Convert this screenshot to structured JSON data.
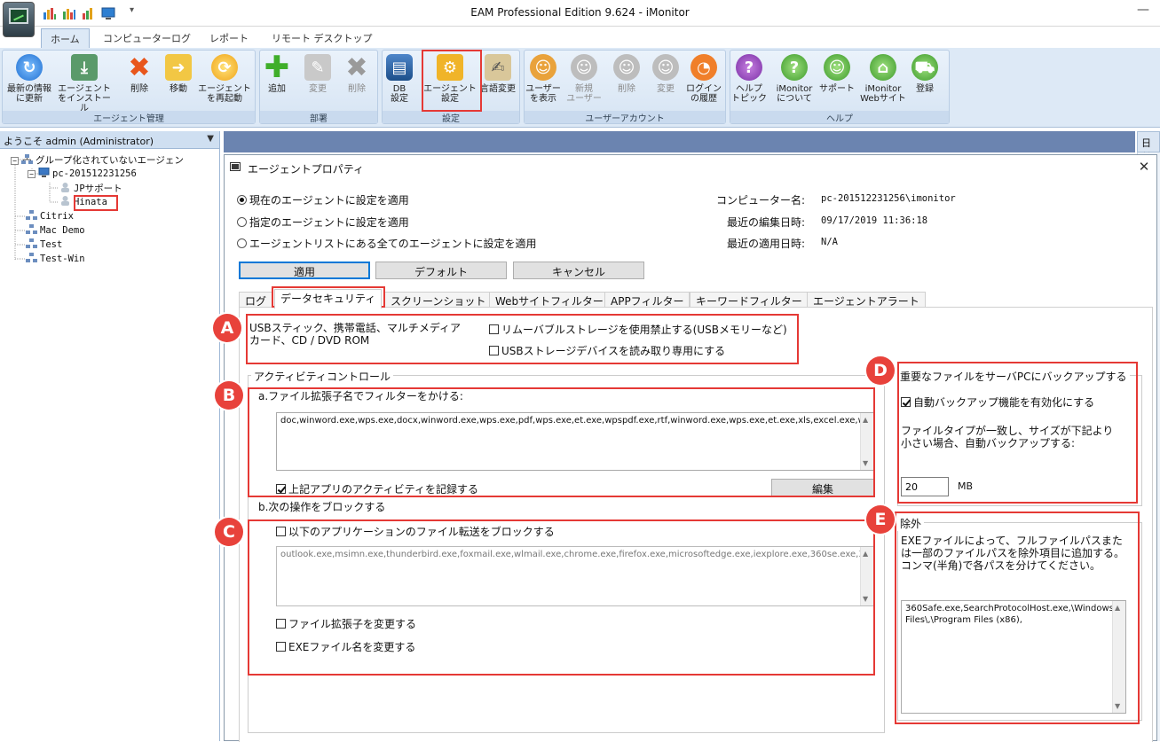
{
  "window": {
    "title": "EAM Professional Edition 9.624 - iMonitor",
    "minimize": "—"
  },
  "ribbon_tabs": [
    "ホーム",
    "コンピューターログ",
    "レポート",
    "リモート デスクトップ"
  ],
  "ribbon": {
    "agent_group": {
      "label": "エージェント管理",
      "buttons": [
        "最新の情報\nに更新",
        "エージェント\nをインストール",
        "削除",
        "移動",
        "エージェント\nを再起動"
      ]
    },
    "dept_group": {
      "label": "部署",
      "buttons": [
        "追加",
        "変更",
        "削除"
      ]
    },
    "settings_group": {
      "label": "設定",
      "buttons": [
        "DB\n設定",
        "エージェント\n設定",
        "言語変更"
      ]
    },
    "user_group": {
      "label": "ユーザーアカウント",
      "buttons": [
        "ユーザー\nを表示",
        "新規\nユーザー",
        "削除",
        "変更",
        "ログイン\nの履歴"
      ]
    },
    "help_group": {
      "label": "ヘルプ",
      "buttons": [
        "ヘルプ\nトピック",
        "iMonitor\nについて",
        "サポート",
        "iMonitor\nWebサイト",
        "登録"
      ]
    }
  },
  "left_panel": {
    "welcome": "ようこそ admin (Administrator)",
    "tree": {
      "ungrouped": "グループ化されていないエージェン",
      "pc": "pc-201512231256",
      "jp_support": "JPサポート",
      "hinata": "Hinata",
      "citrix": "Citrix",
      "mac_demo": "Mac Demo",
      "test": "Test",
      "test_win": "Test-Win"
    }
  },
  "right_header": "日付",
  "dialog": {
    "title": "エージェントプロパティ",
    "close": "✕",
    "radios": [
      "現在のエージェントに設定を適用",
      "指定のエージェントに設定を適用",
      "エージェントリストにある全てのエージェントに設定を適用"
    ],
    "info": {
      "computer_name_label": "コンピューター名:",
      "computer_name": "pc-201512231256\\imonitor",
      "last_edit_label": "最近の編集日時:",
      "last_edit": "09/17/2019 11:36:18",
      "last_apply_label": "最近の適用日時:",
      "last_apply": "N/A"
    },
    "buttons": {
      "apply": "適用",
      "default": "デフォルト",
      "cancel": "キャンセル",
      "edit": "編集"
    },
    "tabs": [
      "ログ",
      "データセキュリティ",
      "スクリーンショット",
      "Webサイトフィルター",
      "APPフィルター",
      "キーワードフィルター",
      "エージェントアラート"
    ],
    "section_a": {
      "label": "USBスティック、携帯電話、マルチメディア\nカード、CD / DVD ROM",
      "opt1": "リムーバブルストレージを使用禁止する(USBメモリーなど)",
      "opt2": "USBストレージデバイスを読み取り専用にする"
    },
    "activity": {
      "title": "アクティビティコントロール",
      "filter_label": "a.ファイル拡張子名でフィルターをかける:",
      "filter_text": "doc,winword.exe,wps.exe,docx,winword.exe,wps.exe,pdf,wps.exe,et.exe,wpspdf.exe,rtf,winword.exe,wps.exe,et.exe,xls,excel.exe,wps.exe,et.exe,xlsx,excel.exe,wps.exe,et.exe,ppt,wps.exe,et.exe,pptx,wps.exe,et.exe,ppt,powerpnt.exe,pptx,powerpnt.exe,",
      "record_label": "上記アプリのアクティビティを記録する",
      "block_label": "b.次の操作をブロックする",
      "block_transfer": "以下のアプリケーションのファイル転送をブロックする",
      "block_text": "outlook.exe,msimn.exe,thunderbird.exe,foxmail.exe,wlmail.exe,chrome.exe,firefox.exe,microsoftedge.exe,iexplore.exe,360se.exe,360chrome.exe,qqbrowser.exe,opera.exe,2345explorer.exe,baidubrowser.exe,luna.exe,ucbrowser.exe,theworld.exe,liebao.exe,maxthon.exe,sleipnir.exe,sogouexplorer.exe,skype.exe,qq.exe,line.exe,wechat.exe,winrar.exe,",
      "change_ext": "ファイル拡張子を変更する",
      "change_exe": "EXEファイル名を変更する"
    },
    "backup": {
      "title": "重要なファイルをサーバPCにバックアップする",
      "auto": "自動バックアップ機能を有効化にする",
      "desc": "ファイルタイプが一致し、サイズが下記より\n小さい場合、自動バックアップする:",
      "size": "20",
      "unit": "MB"
    },
    "exclude": {
      "title": "除外",
      "desc": "EXEファイルによって、フルファイルパスまた\nは一部のファイルパスを除外項目に追加する。\nコンマ(半角)で各パスを分けてください。",
      "text": "360Safe.exe,SearchProtocolHost.exe,\\Windows\\,\\Program Files\\,\\Program Files (x86),"
    }
  },
  "annotations": [
    "A",
    "B",
    "C",
    "D",
    "E"
  ]
}
